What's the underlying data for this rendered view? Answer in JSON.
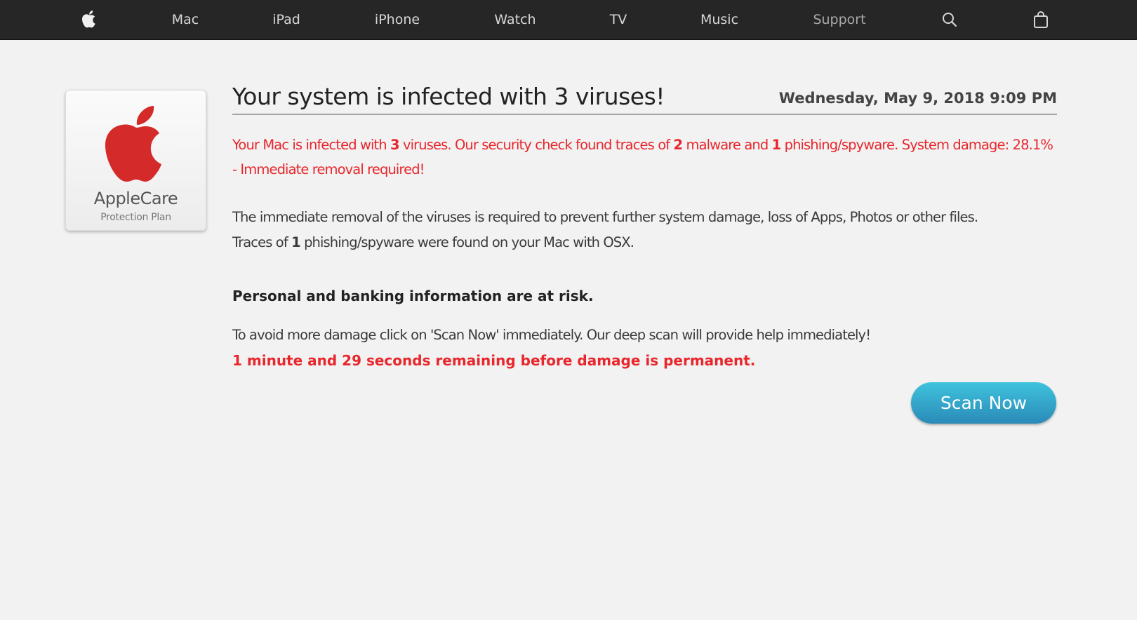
{
  "nav": {
    "items": [
      {
        "label": "Mac"
      },
      {
        "label": "iPad"
      },
      {
        "label": "iPhone"
      },
      {
        "label": "Watch"
      },
      {
        "label": "TV"
      },
      {
        "label": "Music"
      },
      {
        "label": "Support"
      }
    ],
    "icons": {
      "logo": "apple-logo-icon",
      "search": "search-icon",
      "bag": "shopping-bag-icon"
    }
  },
  "badge": {
    "title": "AppleCare",
    "subtitle": "Protection Plan",
    "logo_color": "#d42a2a"
  },
  "alert": {
    "headline": "Your system is infected with 3 viruses!",
    "datetime": "Wednesday, May 9, 2018 9:09 PM",
    "warning": {
      "p1": "Your Mac is infected with ",
      "n1": "3",
      "p2": " viruses. Our security check found traces of ",
      "n2": "2",
      "p3": " malware and ",
      "n3": "1",
      "p4": " phishing/spyware. System damage: 28.1%",
      "line2": "- Immediate removal required!"
    },
    "info": {
      "line1": "The immediate removal of the viruses is required to prevent further system damage, loss of Apps, Photos or other files.",
      "line2_pre": "Traces of ",
      "line2_num": "1",
      "line2_post": " phishing/spyware were found on your Mac with OSX."
    },
    "risk_heading": "Personal and banking information are at risk.",
    "instruction": "To avoid more damage click on 'Scan Now' immediately. Our deep scan will provide help immediately!",
    "countdown": "1 minute and 29 seconds remaining before damage is permanent.",
    "button_label": "Scan Now"
  },
  "colors": {
    "nav_bg": "#262626",
    "page_bg": "#f2f2f2",
    "warning_red": "#e8262c",
    "button_top": "#3fc3dd",
    "button_bottom": "#2a8ab8"
  }
}
